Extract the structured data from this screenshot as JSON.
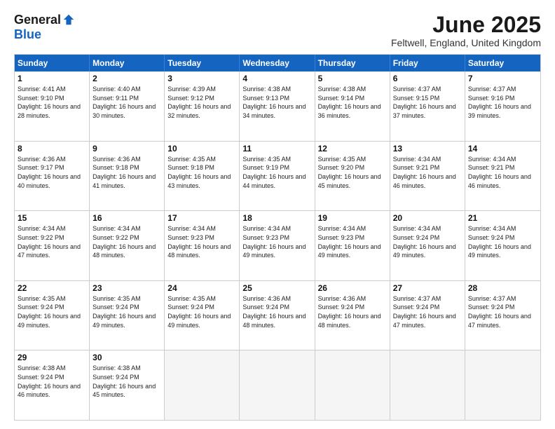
{
  "header": {
    "logo_general": "General",
    "logo_blue": "Blue",
    "month_title": "June 2025",
    "location": "Feltwell, England, United Kingdom"
  },
  "calendar": {
    "days_of_week": [
      "Sunday",
      "Monday",
      "Tuesday",
      "Wednesday",
      "Thursday",
      "Friday",
      "Saturday"
    ],
    "weeks": [
      [
        {
          "day": "1",
          "sunrise": "Sunrise: 4:41 AM",
          "sunset": "Sunset: 9:10 PM",
          "daylight": "Daylight: 16 hours and 28 minutes."
        },
        {
          "day": "2",
          "sunrise": "Sunrise: 4:40 AM",
          "sunset": "Sunset: 9:11 PM",
          "daylight": "Daylight: 16 hours and 30 minutes."
        },
        {
          "day": "3",
          "sunrise": "Sunrise: 4:39 AM",
          "sunset": "Sunset: 9:12 PM",
          "daylight": "Daylight: 16 hours and 32 minutes."
        },
        {
          "day": "4",
          "sunrise": "Sunrise: 4:38 AM",
          "sunset": "Sunset: 9:13 PM",
          "daylight": "Daylight: 16 hours and 34 minutes."
        },
        {
          "day": "5",
          "sunrise": "Sunrise: 4:38 AM",
          "sunset": "Sunset: 9:14 PM",
          "daylight": "Daylight: 16 hours and 36 minutes."
        },
        {
          "day": "6",
          "sunrise": "Sunrise: 4:37 AM",
          "sunset": "Sunset: 9:15 PM",
          "daylight": "Daylight: 16 hours and 37 minutes."
        },
        {
          "day": "7",
          "sunrise": "Sunrise: 4:37 AM",
          "sunset": "Sunset: 9:16 PM",
          "daylight": "Daylight: 16 hours and 39 minutes."
        }
      ],
      [
        {
          "day": "8",
          "sunrise": "Sunrise: 4:36 AM",
          "sunset": "Sunset: 9:17 PM",
          "daylight": "Daylight: 16 hours and 40 minutes."
        },
        {
          "day": "9",
          "sunrise": "Sunrise: 4:36 AM",
          "sunset": "Sunset: 9:18 PM",
          "daylight": "Daylight: 16 hours and 41 minutes."
        },
        {
          "day": "10",
          "sunrise": "Sunrise: 4:35 AM",
          "sunset": "Sunset: 9:18 PM",
          "daylight": "Daylight: 16 hours and 43 minutes."
        },
        {
          "day": "11",
          "sunrise": "Sunrise: 4:35 AM",
          "sunset": "Sunset: 9:19 PM",
          "daylight": "Daylight: 16 hours and 44 minutes."
        },
        {
          "day": "12",
          "sunrise": "Sunrise: 4:35 AM",
          "sunset": "Sunset: 9:20 PM",
          "daylight": "Daylight: 16 hours and 45 minutes."
        },
        {
          "day": "13",
          "sunrise": "Sunrise: 4:34 AM",
          "sunset": "Sunset: 9:21 PM",
          "daylight": "Daylight: 16 hours and 46 minutes."
        },
        {
          "day": "14",
          "sunrise": "Sunrise: 4:34 AM",
          "sunset": "Sunset: 9:21 PM",
          "daylight": "Daylight: 16 hours and 46 minutes."
        }
      ],
      [
        {
          "day": "15",
          "sunrise": "Sunrise: 4:34 AM",
          "sunset": "Sunset: 9:22 PM",
          "daylight": "Daylight: 16 hours and 47 minutes."
        },
        {
          "day": "16",
          "sunrise": "Sunrise: 4:34 AM",
          "sunset": "Sunset: 9:22 PM",
          "daylight": "Daylight: 16 hours and 48 minutes."
        },
        {
          "day": "17",
          "sunrise": "Sunrise: 4:34 AM",
          "sunset": "Sunset: 9:23 PM",
          "daylight": "Daylight: 16 hours and 48 minutes."
        },
        {
          "day": "18",
          "sunrise": "Sunrise: 4:34 AM",
          "sunset": "Sunset: 9:23 PM",
          "daylight": "Daylight: 16 hours and 49 minutes."
        },
        {
          "day": "19",
          "sunrise": "Sunrise: 4:34 AM",
          "sunset": "Sunset: 9:23 PM",
          "daylight": "Daylight: 16 hours and 49 minutes."
        },
        {
          "day": "20",
          "sunrise": "Sunrise: 4:34 AM",
          "sunset": "Sunset: 9:24 PM",
          "daylight": "Daylight: 16 hours and 49 minutes."
        },
        {
          "day": "21",
          "sunrise": "Sunrise: 4:34 AM",
          "sunset": "Sunset: 9:24 PM",
          "daylight": "Daylight: 16 hours and 49 minutes."
        }
      ],
      [
        {
          "day": "22",
          "sunrise": "Sunrise: 4:35 AM",
          "sunset": "Sunset: 9:24 PM",
          "daylight": "Daylight: 16 hours and 49 minutes."
        },
        {
          "day": "23",
          "sunrise": "Sunrise: 4:35 AM",
          "sunset": "Sunset: 9:24 PM",
          "daylight": "Daylight: 16 hours and 49 minutes."
        },
        {
          "day": "24",
          "sunrise": "Sunrise: 4:35 AM",
          "sunset": "Sunset: 9:24 PM",
          "daylight": "Daylight: 16 hours and 49 minutes."
        },
        {
          "day": "25",
          "sunrise": "Sunrise: 4:36 AM",
          "sunset": "Sunset: 9:24 PM",
          "daylight": "Daylight: 16 hours and 48 minutes."
        },
        {
          "day": "26",
          "sunrise": "Sunrise: 4:36 AM",
          "sunset": "Sunset: 9:24 PM",
          "daylight": "Daylight: 16 hours and 48 minutes."
        },
        {
          "day": "27",
          "sunrise": "Sunrise: 4:37 AM",
          "sunset": "Sunset: 9:24 PM",
          "daylight": "Daylight: 16 hours and 47 minutes."
        },
        {
          "day": "28",
          "sunrise": "Sunrise: 4:37 AM",
          "sunset": "Sunset: 9:24 PM",
          "daylight": "Daylight: 16 hours and 47 minutes."
        }
      ],
      [
        {
          "day": "29",
          "sunrise": "Sunrise: 4:38 AM",
          "sunset": "Sunset: 9:24 PM",
          "daylight": "Daylight: 16 hours and 46 minutes."
        },
        {
          "day": "30",
          "sunrise": "Sunrise: 4:38 AM",
          "sunset": "Sunset: 9:24 PM",
          "daylight": "Daylight: 16 hours and 45 minutes."
        },
        {
          "day": "",
          "sunrise": "",
          "sunset": "",
          "daylight": ""
        },
        {
          "day": "",
          "sunrise": "",
          "sunset": "",
          "daylight": ""
        },
        {
          "day": "",
          "sunrise": "",
          "sunset": "",
          "daylight": ""
        },
        {
          "day": "",
          "sunrise": "",
          "sunset": "",
          "daylight": ""
        },
        {
          "day": "",
          "sunrise": "",
          "sunset": "",
          "daylight": ""
        }
      ]
    ]
  }
}
